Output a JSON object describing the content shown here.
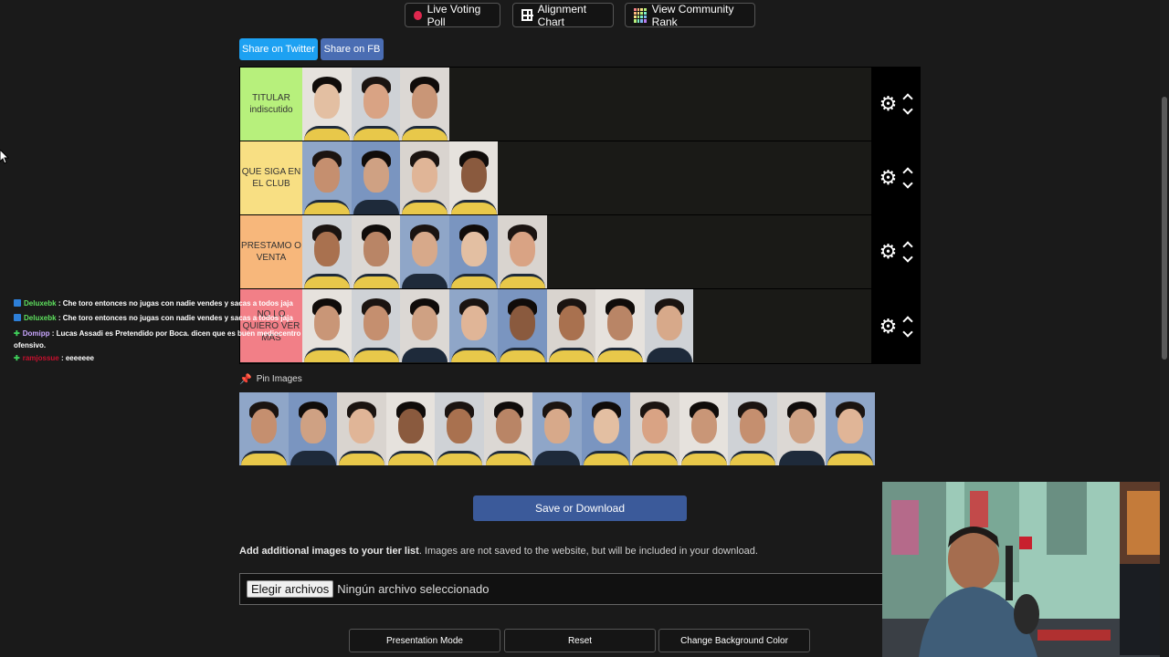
{
  "top_buttons": {
    "live_voting": "Live Voting Poll",
    "alignment": "Alignment Chart",
    "community": "View Community Rank"
  },
  "share": {
    "twitter": "Share on Twitter",
    "fb": "Share on FB"
  },
  "tiers": [
    {
      "label": "TITULAR indiscutido",
      "color": "#b7f07c",
      "count": 3
    },
    {
      "label": "QUE SIGA EN EL CLUB",
      "color": "#f8df83",
      "count": 4
    },
    {
      "label": "PRESTAMO O VENTA",
      "color": "#f7b77b",
      "count": 5
    },
    {
      "label": "NO LO QUIERO VER MAS",
      "color": "#f27f87",
      "count": 8
    }
  ],
  "pin_images_label": "Pin Images",
  "pool_count": 13,
  "save_label": "Save or Download",
  "note": {
    "bold": "Add additional images to your tier list",
    "text": ". Images are not saved to the website, but will be included in your download."
  },
  "file_input": {
    "button": "Elegir archivos",
    "status": "Ningún archivo seleccionado"
  },
  "bottom_buttons": {
    "presentation": "Presentation Mode",
    "reset": "Reset",
    "bg_color": "Change Background Color"
  },
  "chat": [
    {
      "user": "Deluxebk",
      "user_color": "#5ee05e",
      "badge": "blue",
      "message": ": Che toro entonces no jugas con nadie vendes y sacas a todos jaja"
    },
    {
      "user": "Deluxebk",
      "user_color": "#5ee05e",
      "badge": "blue",
      "message": ": Che toro entonces no jugas con nadie vendes y sacas a todos jaja"
    },
    {
      "user": "Domipp",
      "user_color": "#c9a6ff",
      "badge": "plus",
      "message": ": Lucas Assadi es Pretendido por Boca. dicen que es buen mediocentro ofensivo."
    },
    {
      "user": "ramjossue",
      "user_color": "#c8102e",
      "badge": "plus",
      "message": ": eeeeeee"
    }
  ],
  "colors": {
    "save_button": "#3b5a9a",
    "twitter": "#1da1f2",
    "fb": "#4a6db3"
  }
}
